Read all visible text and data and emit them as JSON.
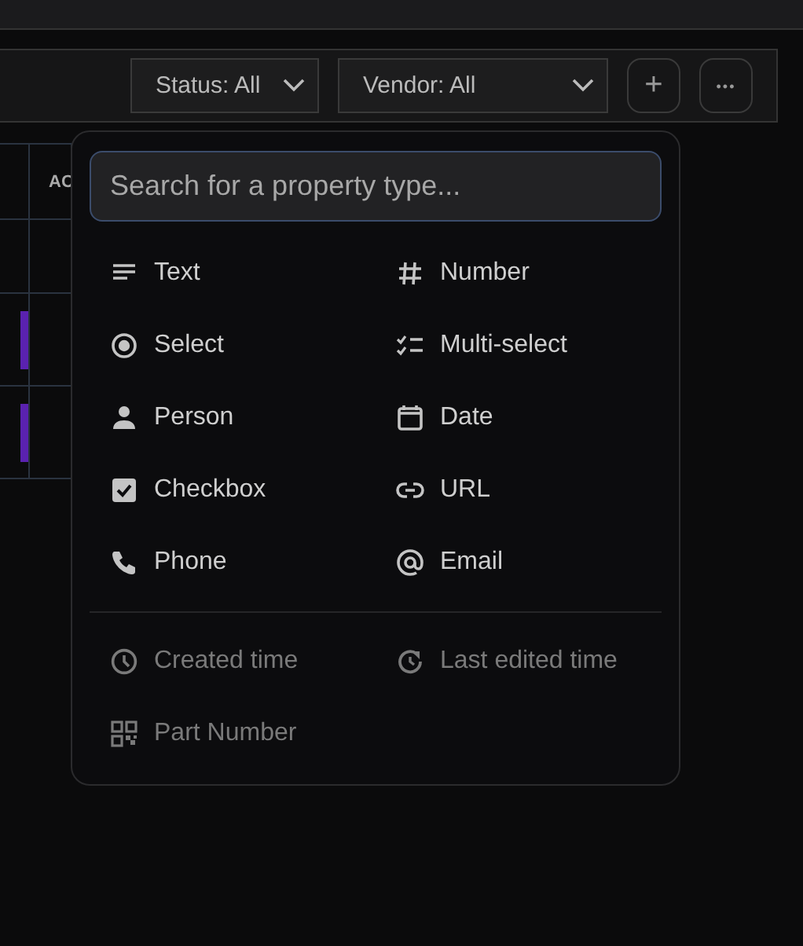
{
  "toolbar": {
    "filters": [
      {
        "label": "Status: All"
      },
      {
        "label": "Vendor: All"
      }
    ],
    "buttons": [
      {
        "kind": "add",
        "label": "+"
      },
      {
        "kind": "more",
        "label": "•••"
      }
    ]
  },
  "table": {
    "columns": [
      "AC"
    ],
    "rows": [
      {
        "kind": "plain"
      },
      {
        "kind": "action"
      },
      {
        "kind": "action"
      }
    ]
  },
  "property_menu": {
    "search": {
      "placeholder": "Search for a property type..."
    },
    "sections": [
      {
        "items": [
          {
            "label": "Text",
            "disabled": false
          },
          {
            "label": "Number",
            "disabled": false
          },
          {
            "label": "Select",
            "disabled": false
          },
          {
            "label": "Multi-select",
            "disabled": false
          },
          {
            "label": "Person",
            "disabled": false
          },
          {
            "label": "Date",
            "disabled": false
          },
          {
            "label": "Checkbox",
            "disabled": false
          },
          {
            "label": "URL",
            "disabled": false
          },
          {
            "label": "Phone",
            "disabled": false
          },
          {
            "label": "Email",
            "disabled": false
          }
        ]
      },
      {
        "items": [
          {
            "label": "Created time",
            "disabled": true
          },
          {
            "label": "Last edited time",
            "disabled": true
          },
          {
            "label": "Part Number",
            "disabled": true
          }
        ]
      }
    ]
  }
}
